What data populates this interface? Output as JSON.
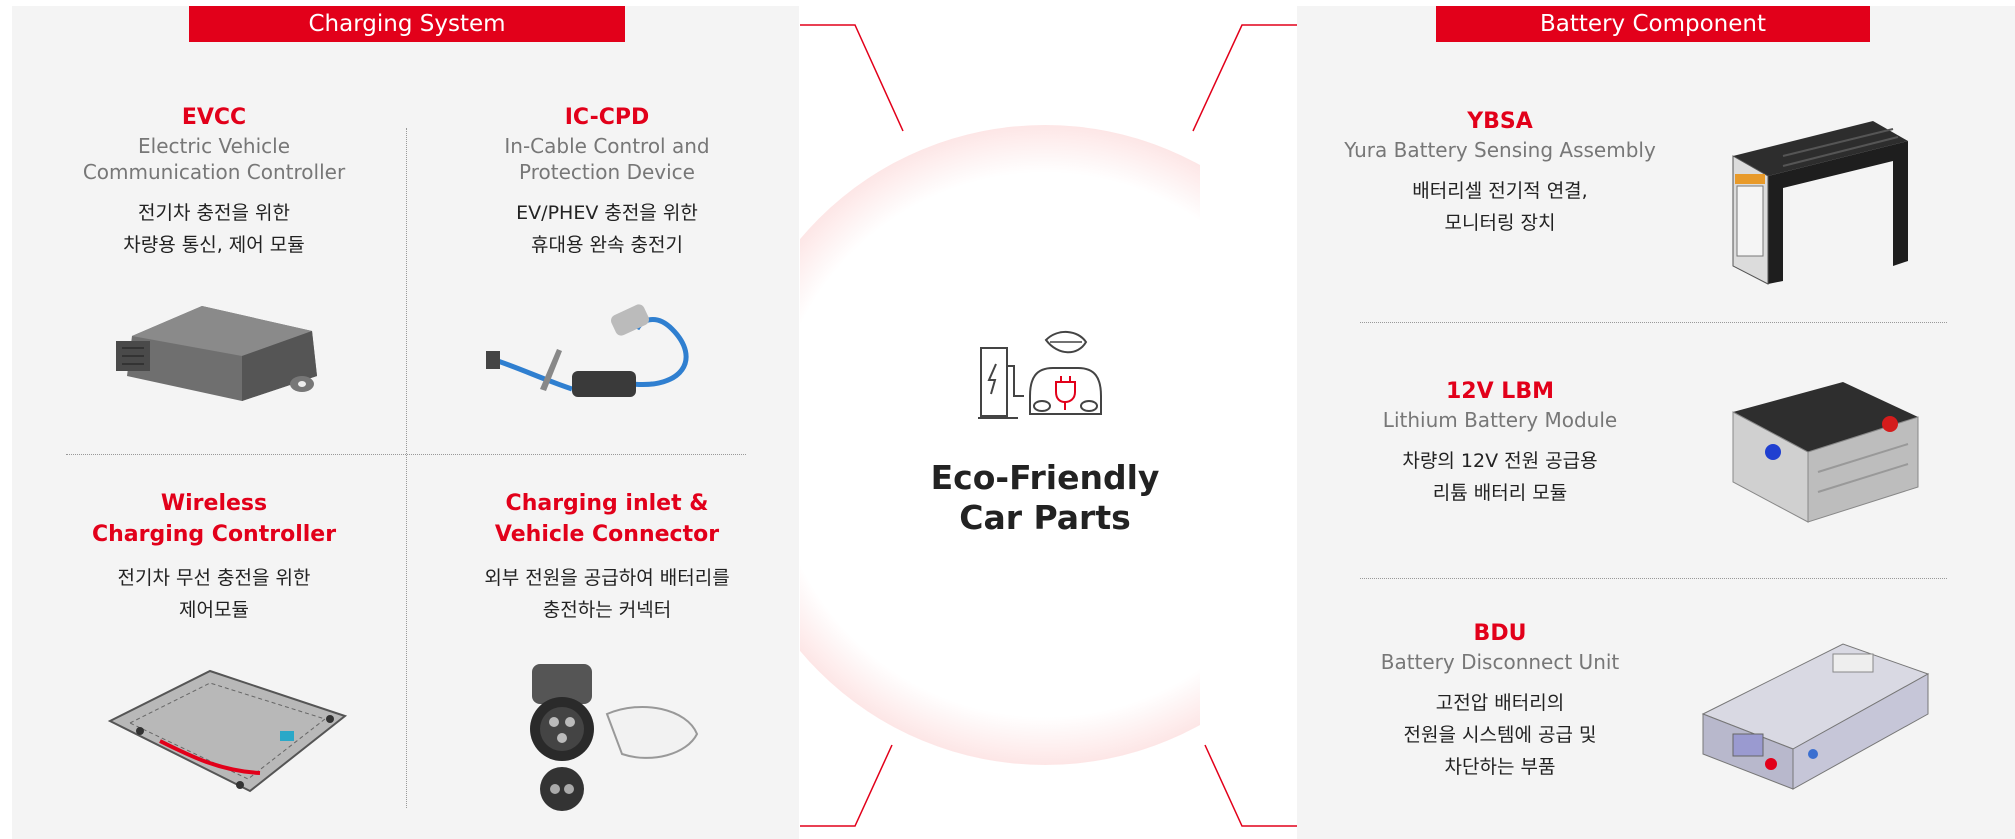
{
  "left": {
    "banner": "Charging System",
    "items": [
      {
        "name": "EVCC",
        "sub1": "Electric Vehicle",
        "sub2": "Communication Controller",
        "desc1": "전기차 충전을 위한",
        "desc2": "차량용 통신, 제어 모듈",
        "icon": "control-module"
      },
      {
        "name": "IC-CPD",
        "sub1": "In-Cable Control and",
        "sub2": "Protection Device",
        "desc1": "EV/PHEV 충전을 위한",
        "desc2": "휴대용 완속 충전기",
        "icon": "charging-cable"
      },
      {
        "name1": "Wireless",
        "name2": "Charging Controller",
        "desc1": "전기차 무선 충전을 위한",
        "desc2": "제어모듈",
        "icon": "circuit-board"
      },
      {
        "name1": "Charging inlet &",
        "name2": "Vehicle Connector",
        "desc1": "외부 전원을 공급하여 배터리를",
        "desc2": "충전하는 커넥터",
        "icon": "charge-connector"
      }
    ]
  },
  "center": {
    "title1": "Eco-Friendly",
    "title2": "Car Parts",
    "icon": "eco-car-charging",
    "accent": "#e2001a"
  },
  "right": {
    "banner": "Battery Component",
    "items": [
      {
        "name": "YBSA",
        "sub": "Yura Battery Sensing Assembly",
        "desc1": "배터리셀 전기적 연결,",
        "desc2": "모니터링 장치",
        "icon": "sensing-assembly"
      },
      {
        "name": "12V LBM",
        "sub": "Lithium Battery Module",
        "desc1": "차량의 12V 전원 공급용",
        "desc2": "리튬 배터리 모듈",
        "icon": "battery-module"
      },
      {
        "name": "BDU",
        "sub": "Battery Disconnect Unit",
        "desc1": "고전압 배터리의",
        "desc2": "전원을 시스템에 공급 및",
        "desc3": "차단하는 부품",
        "icon": "disconnect-unit"
      }
    ]
  }
}
